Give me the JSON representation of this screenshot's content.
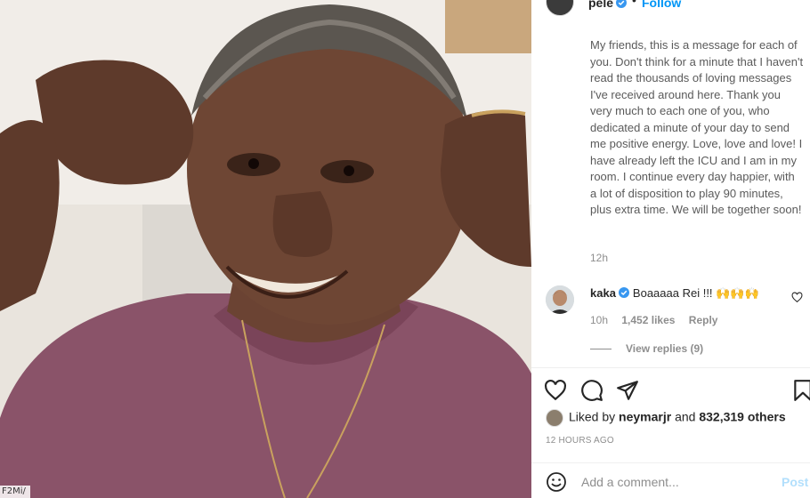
{
  "photo": {
    "tag": "F2Mi/"
  },
  "header": {
    "username": "pele",
    "separator": "•",
    "follow_label": "Follow"
  },
  "caption": {
    "text": "My friends, this is a message for each of you. Don't think for a minute that I haven't read the thousands of loving messages I've received around here. Thank you very much to each one of you, who dedicated a minute of your day to send me positive energy. Love, love and love! I have already left the ICU and I am in my room. I continue every day happier, with a lot of disposition to play 90 minutes, plus extra time. We will be together soon!",
    "time": "12h"
  },
  "comment": {
    "username": "kaka",
    "text": "Boaaaaa Rei !!! 🙌🙌🙌",
    "time": "10h",
    "likes": "1,452 likes",
    "reply_label": "Reply",
    "view_replies": "View replies (9)"
  },
  "actions": {
    "icons": [
      "heart-icon",
      "comment-icon",
      "share-icon",
      "bookmark-icon"
    ]
  },
  "likes": {
    "prefix": "Liked by",
    "user": "neymarjr",
    "connector": "and",
    "others": "832,319 others"
  },
  "post_time": "12 HOURS AGO",
  "add_comment": {
    "placeholder": "Add a comment...",
    "post_label": "Post"
  },
  "colors": {
    "accent": "#0095f6",
    "verified": "#3897f0",
    "muted": "#8e8e8e",
    "shirt": "#8a5369"
  }
}
